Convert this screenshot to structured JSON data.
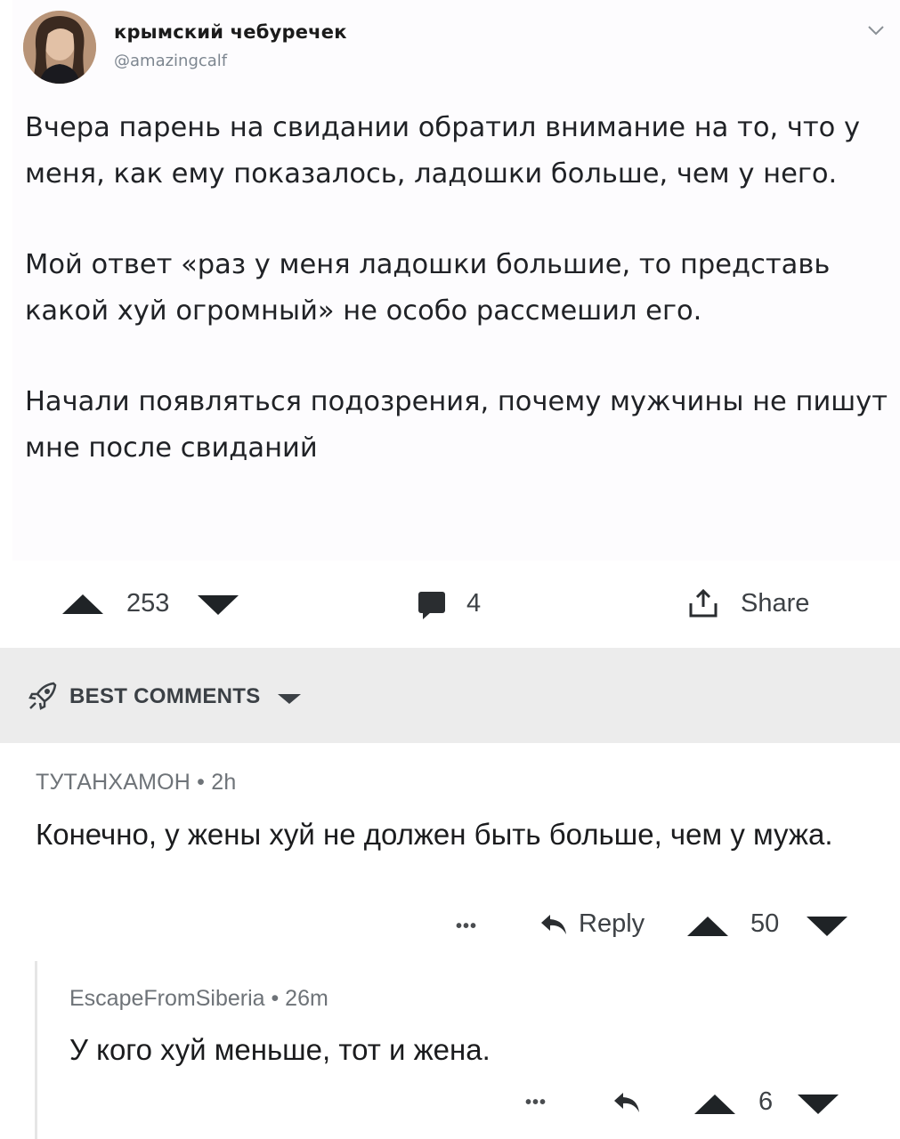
{
  "tweet": {
    "display_name": "крымский чебуречек",
    "handle": "@amazingcalf",
    "paragraphs": [
      "Вчера парень на свидании обратил внимание на то, что у меня, как ему показалось, ладошки больше, чем у него.",
      "Мой ответ «раз у меня ладошки большие, то представь какой хуй огромный» не особо рассмешил его.",
      "Начали появляться подозрения, почему мужчины не пишут мне после свиданий"
    ]
  },
  "post_actions": {
    "score": "253",
    "comments_count": "4",
    "share_label": "Share"
  },
  "comments_header": {
    "label": "BEST COMMENTS"
  },
  "comments": [
    {
      "meta": "ТУТАНХАМОН • 2h",
      "text": "Конечно, у жены хуй не должен быть больше, чем у мужа.",
      "more": "•••",
      "reply_label": "Reply",
      "score": "50"
    },
    {
      "meta": "EscapeFromSiberia • 26m",
      "text": "У кого хуй меньше, тот и жена.",
      "more": "•••",
      "score": "6"
    }
  ]
}
